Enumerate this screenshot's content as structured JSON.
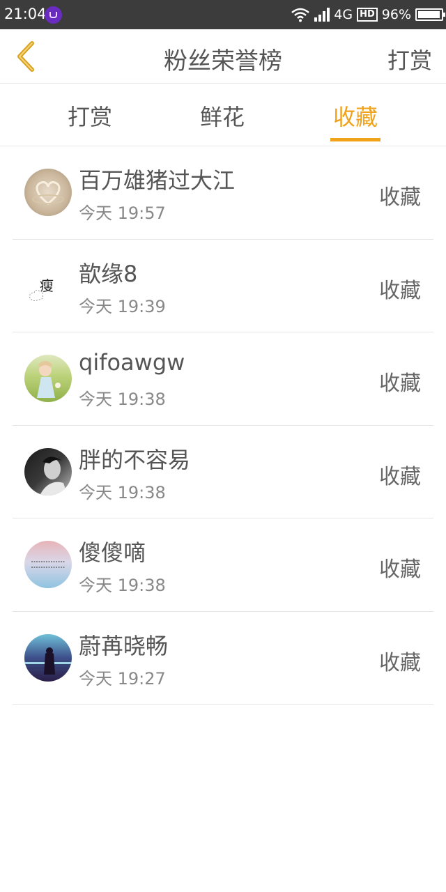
{
  "status_bar": {
    "time": "21:04",
    "network": "4G",
    "hd": "HD",
    "battery": "96%",
    "battery_level": 0.96
  },
  "header": {
    "back_icon": "chevron-left-icon",
    "title": "粉丝荣誉榜",
    "right_action": "打赏",
    "accent_color": "#f0a21a"
  },
  "tabs": [
    {
      "label": "打赏",
      "active": false
    },
    {
      "label": "鲜花",
      "active": false
    },
    {
      "label": "收藏",
      "active": true
    }
  ],
  "fans": [
    {
      "name": "百万雄猪过大江",
      "day": "今天",
      "time": "19:57",
      "action": "收藏",
      "avatar": "ring-avatar"
    },
    {
      "name": "歆缘8",
      "day": "今天",
      "time": "19:39",
      "action": "收藏",
      "avatar": "calligraphy-avatar",
      "avatar_text": "瘦"
    },
    {
      "name": "qifoawgw",
      "day": "今天",
      "time": "19:38",
      "action": "收藏",
      "avatar": "child-photo-avatar"
    },
    {
      "name": "胖的不容易",
      "day": "今天",
      "time": "19:38",
      "action": "收藏",
      "avatar": "bw-portrait-avatar"
    },
    {
      "name": "傻傻嘀",
      "day": "今天",
      "time": "19:38",
      "action": "收藏",
      "avatar": "sky-text-avatar"
    },
    {
      "name": "蔚苒晓畅",
      "day": "今天",
      "time": "19:27",
      "action": "收藏",
      "avatar": "night-girl-avatar"
    }
  ]
}
